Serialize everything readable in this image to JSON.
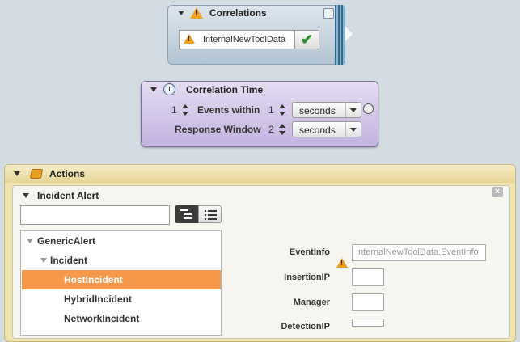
{
  "correlations": {
    "title": "Correlations",
    "item_label": "InternalNewToolData"
  },
  "correlation_time": {
    "title": "Correlation Time",
    "row1": {
      "count": "1",
      "label": "Events within",
      "amount": "1",
      "unit": "seconds"
    },
    "row2": {
      "label": "Response Window",
      "amount": "2",
      "unit": "seconds"
    }
  },
  "actions": {
    "title": "Actions",
    "panel_title": "Incident Alert",
    "search": {
      "value": "",
      "placeholder": ""
    },
    "tree": [
      {
        "label": "GenericAlert",
        "level": 0,
        "expanded": true
      },
      {
        "label": "Incident",
        "level": 1,
        "expanded": true
      },
      {
        "label": "HostIncident",
        "level": 2,
        "selected": true
      },
      {
        "label": "HybridIncident",
        "level": 2
      },
      {
        "label": "NetworkIncident",
        "level": 2
      }
    ],
    "properties": {
      "event_info": {
        "label": "EventInfo",
        "value": "InternalNewToolData.EventInfo"
      },
      "insertion_ip": {
        "label": "InsertionIP",
        "value": ""
      },
      "manager": {
        "label": "Manager",
        "value": ""
      },
      "detection_ip": {
        "label": "DetectionIP",
        "value": ""
      }
    }
  },
  "colors": {
    "background": "#d3dce3",
    "correlations_panel": "#c7d4df",
    "correlation_time_panel": "#d2c6ea",
    "actions_panel": "#efe3b0",
    "selection": "#f7994b",
    "warning": "#f0a020",
    "check": "#2f8f2f"
  },
  "icons": {
    "correlations": "warning-icon",
    "correlation_time": "clock-icon",
    "actions": "actions-icon"
  }
}
